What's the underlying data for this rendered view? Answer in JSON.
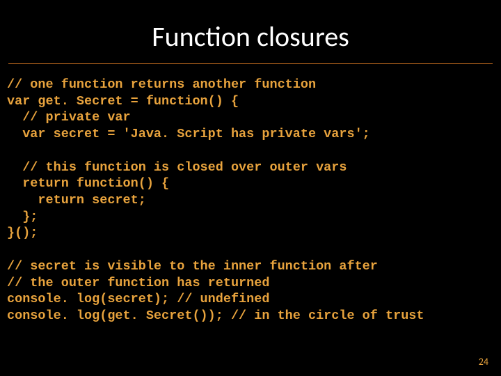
{
  "title": "Function closures",
  "code": {
    "l1": "// one function returns another function",
    "l2": "var get. Secret = function() {",
    "l3": "  // private var",
    "l4": "  var secret = 'Java. Script has private vars';",
    "l5": "  // this function is closed over outer vars",
    "l6": "  return function() {",
    "l7": "    return secret;",
    "l8": "  };",
    "l9": "}();",
    "l10": "// secret is visible to the inner function after",
    "l11": "// the outer function has returned",
    "l12": "console. log(secret); // undefined",
    "l13": "console. log(get. Secret()); // in the circle of trust"
  },
  "page_number": "24"
}
